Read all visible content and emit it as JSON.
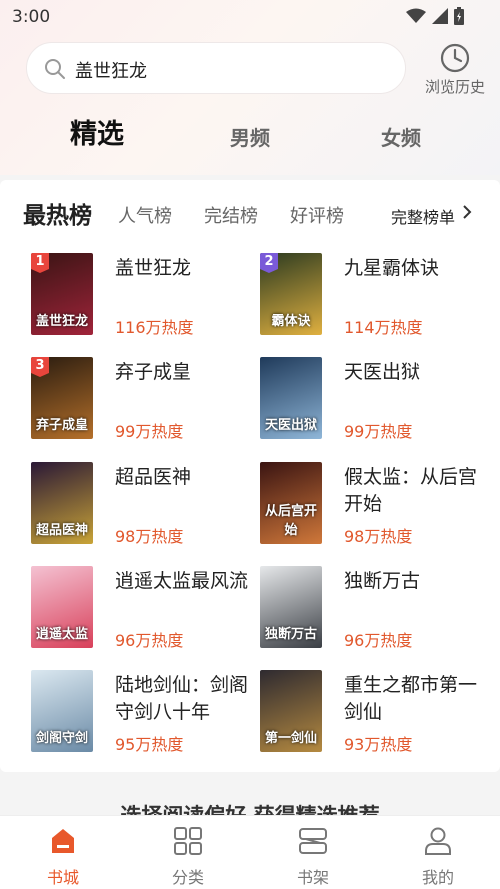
{
  "status_bar": {
    "time": "3:00"
  },
  "search": {
    "value": "盖世狂龙"
  },
  "history": {
    "label": "浏览历史"
  },
  "tabs": [
    {
      "label": "精选",
      "active": true
    },
    {
      "label": "男频",
      "active": false
    },
    {
      "label": "女频",
      "active": false
    }
  ],
  "rank_tabs": {
    "active": "最热榜",
    "items": [
      "人气榜",
      "完结榜",
      "好评榜"
    ],
    "full_list": "完整榜单"
  },
  "books": [
    {
      "rank": "1",
      "title": "盖世狂龙",
      "heat": "116万热度",
      "badge_color": "#e8453c",
      "cover_colors": [
        "#3a1414",
        "#a0243a"
      ],
      "cover_text": "盖世狂龙"
    },
    {
      "rank": "2",
      "title": "九星霸体诀",
      "heat": "114万热度",
      "badge_color": "#7a5ad8",
      "cover_colors": [
        "#2b3a20",
        "#e0b040"
      ],
      "cover_text": "霸体诀"
    },
    {
      "rank": "3",
      "title": "弃子成皇",
      "heat": "99万热度",
      "badge_color": "#e8453c",
      "cover_colors": [
        "#2a1c10",
        "#b5702a"
      ],
      "cover_text": "弃子成皇"
    },
    {
      "rank": "",
      "title": "天医出狱",
      "heat": "99万热度",
      "badge_color": "",
      "cover_colors": [
        "#1f3a5a",
        "#8fb6d8"
      ],
      "cover_text": "天医出狱"
    },
    {
      "rank": "",
      "title": "超品医神",
      "heat": "98万热度",
      "badge_color": "",
      "cover_colors": [
        "#2a1836",
        "#c9a437"
      ],
      "cover_text": "超品医神"
    },
    {
      "rank": "",
      "title": "假太监：从后宫开始",
      "heat": "98万热度",
      "badge_color": "",
      "cover_colors": [
        "#3a1412",
        "#d0783a"
      ],
      "cover_text": "从后宫开始"
    },
    {
      "rank": "",
      "title": "逍遥太监最风流",
      "heat": "96万热度",
      "badge_color": "",
      "cover_colors": [
        "#f4c2d2",
        "#d8405a"
      ],
      "cover_text": "逍遥太监"
    },
    {
      "rank": "",
      "title": "独断万古",
      "heat": "96万热度",
      "badge_color": "",
      "cover_colors": [
        "#e6e8ea",
        "#3a3e44"
      ],
      "cover_text": "独断万古"
    },
    {
      "rank": "",
      "title": "陆地剑仙：剑阁守剑八十年",
      "heat": "95万热度",
      "badge_color": "",
      "cover_colors": [
        "#dbe8f0",
        "#6a8aa6"
      ],
      "cover_text": "剑阁守剑"
    },
    {
      "rank": "",
      "title": "重生之都市第一剑仙",
      "heat": "93万热度",
      "badge_color": "",
      "cover_colors": [
        "#2e2a30",
        "#b58a40"
      ],
      "cover_text": "第一剑仙"
    }
  ],
  "slogan": "选择阅读偏好 获得精选推荐",
  "bottom_nav": [
    {
      "label": "书城",
      "icon": "bookstore-icon",
      "active": true
    },
    {
      "label": "分类",
      "icon": "category-grid-icon",
      "active": false
    },
    {
      "label": "书架",
      "icon": "bookshelf-icon",
      "active": false
    },
    {
      "label": "我的",
      "icon": "profile-icon",
      "active": false
    }
  ],
  "colors": {
    "accent": "#e8582b",
    "heat": "#e1582d"
  }
}
